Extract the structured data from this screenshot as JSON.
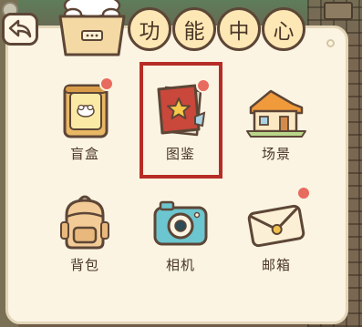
{
  "title": {
    "chars": [
      "功",
      "能",
      "中",
      "心"
    ]
  },
  "items": [
    {
      "label": "盲盒",
      "icon": "blind-box-icon",
      "badge": true
    },
    {
      "label": "图鉴",
      "icon": "collection-book-icon",
      "badge": true,
      "highlighted": true
    },
    {
      "label": "场景",
      "icon": "house-scene-icon",
      "badge": false
    },
    {
      "label": "背包",
      "icon": "backpack-icon",
      "badge": false
    },
    {
      "label": "相机",
      "icon": "camera-icon",
      "badge": false
    },
    {
      "label": "邮箱",
      "icon": "envelope-icon",
      "badge": true
    }
  ],
  "colors": {
    "panel": "#fbf4e3",
    "outline": "#5d4636",
    "title_pill": "#fde8b5",
    "highlight_border": "#b72c26",
    "badge": "#e76b5e"
  }
}
